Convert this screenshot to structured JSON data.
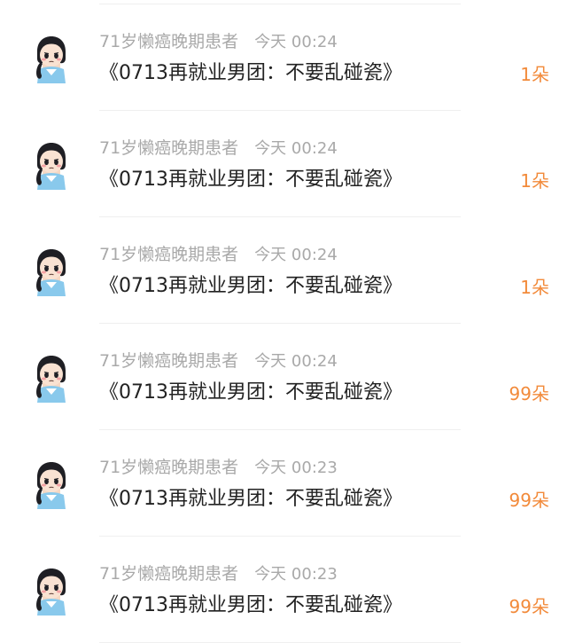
{
  "comments": [
    {
      "user": "71岁懒癌晚期患者",
      "time": "今天 00:24",
      "text": "《0713再就业男团：不要乱碰瓷》",
      "gift": "1朵"
    },
    {
      "user": "71岁懒癌晚期患者",
      "time": "今天 00:24",
      "text": "《0713再就业男团：不要乱碰瓷》",
      "gift": "1朵"
    },
    {
      "user": "71岁懒癌晚期患者",
      "time": "今天 00:24",
      "text": "《0713再就业男团：不要乱碰瓷》",
      "gift": "1朵"
    },
    {
      "user": "71岁懒癌晚期患者",
      "time": "今天 00:24",
      "text": "《0713再就业男团：不要乱碰瓷》",
      "gift": "99朵"
    },
    {
      "user": "71岁懒癌晚期患者",
      "time": "今天 00:23",
      "text": "《0713再就业男团：不要乱碰瓷》",
      "gift": "99朵"
    },
    {
      "user": "71岁懒癌晚期患者",
      "time": "今天 00:23",
      "text": "《0713再就业男团：不要乱碰瓷》",
      "gift": "99朵"
    }
  ],
  "colors": {
    "gift": "#f28a3a",
    "meta": "#a9a9a9",
    "text": "#222222"
  },
  "icons": {
    "avatar": "cartoon-girl-avatar-icon"
  }
}
